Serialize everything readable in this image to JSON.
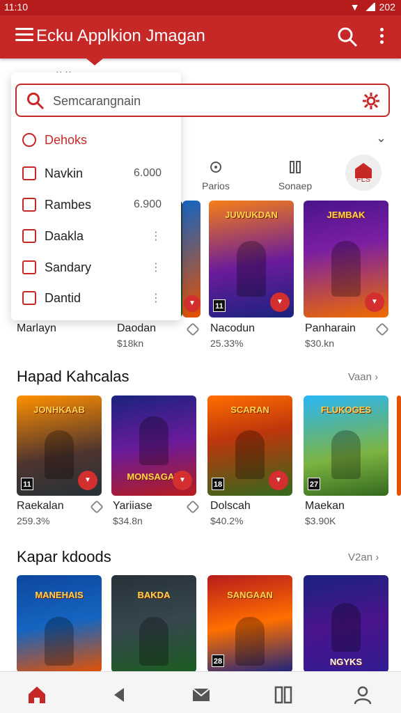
{
  "status_bar": {
    "time": "11:10",
    "right_text": "202"
  },
  "app_bar": {
    "title": "Ecku Applkion Jmagan"
  },
  "search": {
    "placeholder": "Semcarangnain"
  },
  "dropdown": {
    "items": [
      {
        "label": "Dehoks",
        "value": ""
      },
      {
        "label": "Navkin",
        "value": "6.000"
      },
      {
        "label": "Rambes",
        "value": "6.900"
      },
      {
        "label": "Daakla",
        "value": ""
      },
      {
        "label": "Sandary",
        "value": ""
      },
      {
        "label": "Dantid",
        "value": ""
      }
    ]
  },
  "categories": [
    {
      "label": "Parios"
    },
    {
      "label": "Sonaep"
    },
    {
      "label": "FLS"
    }
  ],
  "row1": {
    "cards": [
      {
        "name": "Marlayn",
        "sub": "",
        "badge": "",
        "art_title": ""
      },
      {
        "name": "Daodan",
        "sub": "$18kn",
        "badge": "",
        "art_title": ""
      },
      {
        "name": "Nacodun",
        "sub": "25.33%",
        "badge": "11",
        "art_title": "JUWUKDAN"
      },
      {
        "name": "Panharain",
        "sub": "$30.kn",
        "badge": "",
        "art_title": "JEMBAK"
      }
    ]
  },
  "section2": {
    "title": "Hapad Kahcalas",
    "see_all": "Vaan",
    "cards": [
      {
        "name": "Raekalan",
        "sub": "259.3%",
        "badge": "11",
        "art_title": "JONHKAAB"
      },
      {
        "name": "Yariiase",
        "sub": "$34.8n",
        "badge": "",
        "art_title": "MONSAGAN"
      },
      {
        "name": "Dolscah",
        "sub": "$40.2%",
        "badge": "18",
        "art_title": "SCARAN"
      },
      {
        "name": "Maekan",
        "sub": "$3.90K",
        "badge": "27",
        "art_title": "FLUKOGES"
      }
    ]
  },
  "section3": {
    "title": "Kapar kdoods",
    "see_all": "V2an",
    "cards": [
      {
        "name": "",
        "sub": "",
        "badge": "",
        "art_title": "MANEHAIS"
      },
      {
        "name": "",
        "sub": "",
        "badge": "",
        "art_title": "BAKDA"
      },
      {
        "name": "",
        "sub": "",
        "badge": "28",
        "art_title": "SANGAAN"
      },
      {
        "name": "",
        "sub": "",
        "badge": "",
        "art_title": "NGYKS"
      }
    ]
  },
  "bottom_nav": [
    {
      "icon": "home-icon"
    },
    {
      "icon": "back-icon"
    },
    {
      "icon": "mail-icon"
    },
    {
      "icon": "book-icon"
    },
    {
      "icon": "user-icon"
    }
  ],
  "colors": {
    "accent": "#c62828",
    "dark_accent": "#b71c1c"
  }
}
